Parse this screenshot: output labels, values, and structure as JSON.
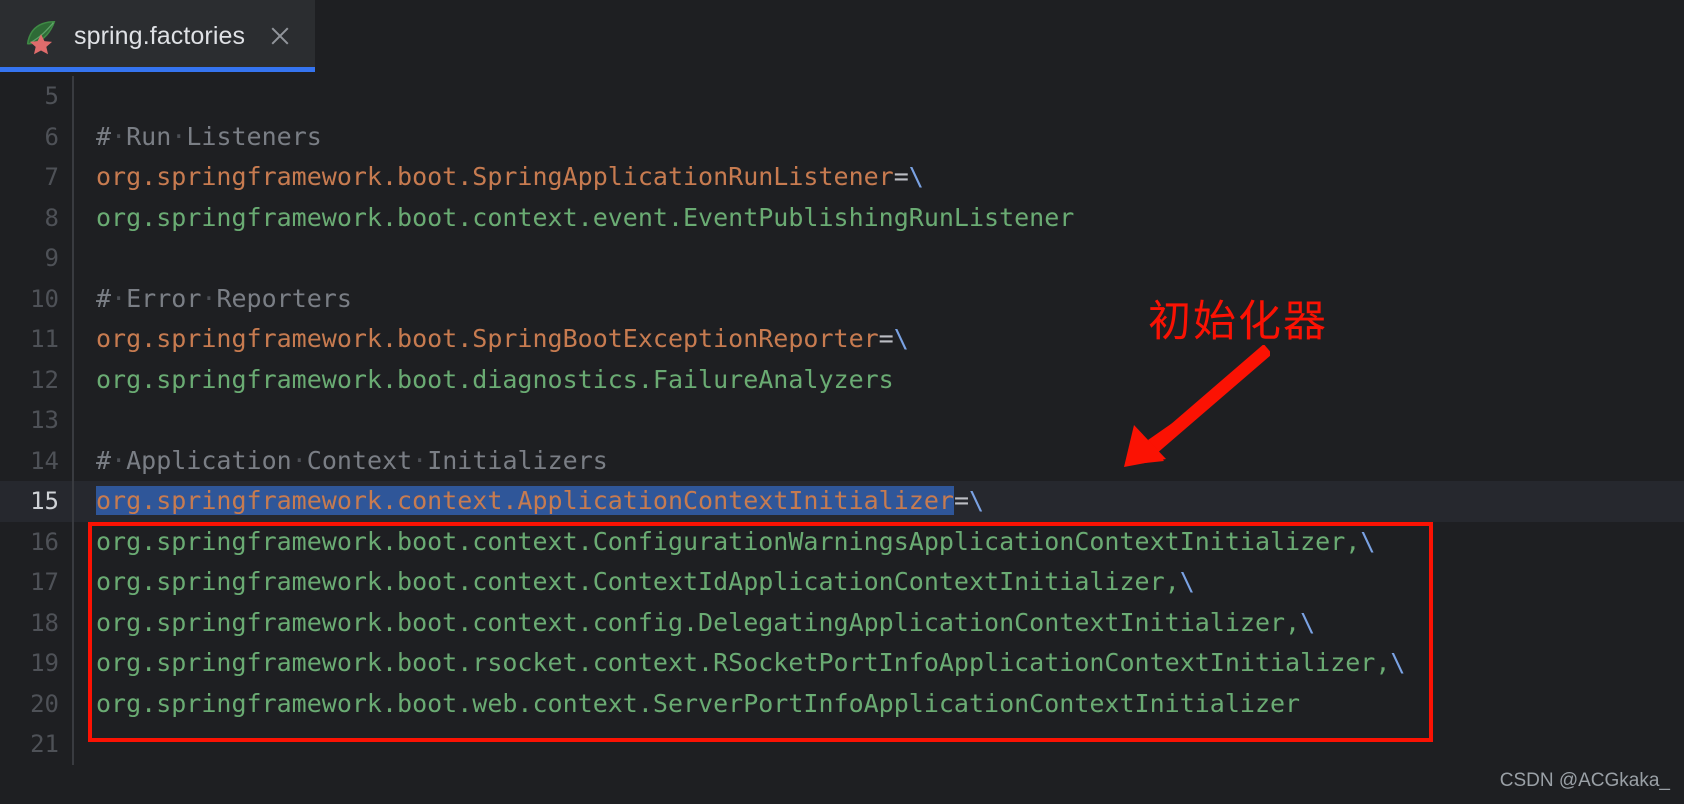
{
  "tab": {
    "title": "spring.factories",
    "icon": "spring-leaf-icon",
    "close_label": "×",
    "accent_color": "#3574f0"
  },
  "editor": {
    "background": "#1e1f22",
    "current_line": 15,
    "selection_color": "#2f5699",
    "colors": {
      "key": "#c77b50",
      "value": "#6aab73",
      "comment": "#7a7e85",
      "equals": "#bcbec4",
      "escape": "#7aa2e3"
    },
    "lines": [
      {
        "num": "5",
        "tokens": []
      },
      {
        "num": "6",
        "tokens": [
          {
            "t": "comment",
            "s": "#"
          },
          {
            "t": "dot",
            "s": "·"
          },
          {
            "t": "comment",
            "s": "Run"
          },
          {
            "t": "dot",
            "s": "·"
          },
          {
            "t": "comment",
            "s": "Listeners"
          }
        ]
      },
      {
        "num": "7",
        "tokens": [
          {
            "t": "key",
            "s": "org.springframework.boot.SpringApplicationRunListener"
          },
          {
            "t": "equals",
            "s": "="
          },
          {
            "t": "escape",
            "s": "\\"
          }
        ]
      },
      {
        "num": "8",
        "tokens": [
          {
            "t": "value",
            "s": "org.springframework.boot.context.event.EventPublishingRunListener"
          }
        ]
      },
      {
        "num": "9",
        "tokens": []
      },
      {
        "num": "10",
        "tokens": [
          {
            "t": "comment",
            "s": "#"
          },
          {
            "t": "dot",
            "s": "·"
          },
          {
            "t": "comment",
            "s": "Error"
          },
          {
            "t": "dot",
            "s": "·"
          },
          {
            "t": "comment",
            "s": "Reporters"
          }
        ]
      },
      {
        "num": "11",
        "tokens": [
          {
            "t": "key",
            "s": "org.springframework.boot.SpringBootExceptionReporter"
          },
          {
            "t": "equals",
            "s": "="
          },
          {
            "t": "escape",
            "s": "\\"
          }
        ]
      },
      {
        "num": "12",
        "tokens": [
          {
            "t": "value",
            "s": "org.springframework.boot.diagnostics.FailureAnalyzers"
          }
        ]
      },
      {
        "num": "13",
        "tokens": []
      },
      {
        "num": "14",
        "tokens": [
          {
            "t": "comment",
            "s": "#"
          },
          {
            "t": "dot",
            "s": "·"
          },
          {
            "t": "comment",
            "s": "Application"
          },
          {
            "t": "dot",
            "s": "·"
          },
          {
            "t": "comment",
            "s": "Context"
          },
          {
            "t": "dot",
            "s": "·"
          },
          {
            "t": "comment",
            "s": "Initializers"
          }
        ]
      },
      {
        "num": "15",
        "current": true,
        "tokens": [
          {
            "t": "selected",
            "s": "org.springframework.context.ApplicationContextInitializer"
          },
          {
            "t": "equals",
            "s": "="
          },
          {
            "t": "escape",
            "s": "\\"
          }
        ]
      },
      {
        "num": "16",
        "tokens": [
          {
            "t": "value",
            "s": "org.springframework.boot.context.ConfigurationWarningsApplicationContextInitializer,"
          },
          {
            "t": "escape",
            "s": "\\"
          }
        ]
      },
      {
        "num": "17",
        "tokens": [
          {
            "t": "value",
            "s": "org.springframework.boot.context.ContextIdApplicationContextInitializer,"
          },
          {
            "t": "escape",
            "s": "\\"
          }
        ]
      },
      {
        "num": "18",
        "tokens": [
          {
            "t": "value",
            "s": "org.springframework.boot.context.config.DelegatingApplicationContextInitializer,"
          },
          {
            "t": "escape",
            "s": "\\"
          }
        ]
      },
      {
        "num": "19",
        "tokens": [
          {
            "t": "value",
            "s": "org.springframework.boot.rsocket.context.RSocketPortInfoApplicationContextInitializer,"
          },
          {
            "t": "escape",
            "s": "\\"
          }
        ]
      },
      {
        "num": "20",
        "tokens": [
          {
            "t": "value",
            "s": "org.springframework.boot.web.context.ServerPortInfoApplicationContextInitializer"
          }
        ]
      },
      {
        "num": "21",
        "tokens": []
      }
    ]
  },
  "annotations": {
    "label": "初始化器",
    "color": "#fb1203",
    "arrow": "red-arrow-down-left",
    "box": "red-highlight-box"
  },
  "watermark": {
    "text": "CSDN @ACGkaka_"
  }
}
